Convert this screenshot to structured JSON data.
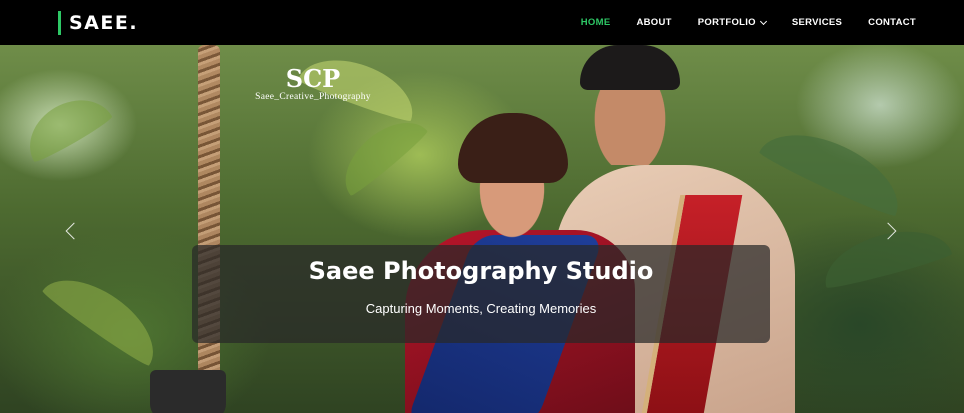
{
  "brand": {
    "name": "SAEE.",
    "accent": "#2ec866"
  },
  "nav": {
    "items": [
      {
        "label": "HOME",
        "active": true
      },
      {
        "label": "ABOUT",
        "active": false
      },
      {
        "label": "PORTFOLIO",
        "active": false,
        "has_dropdown": true
      },
      {
        "label": "SERVICES",
        "active": false
      },
      {
        "label": "CONTACT",
        "active": false
      }
    ]
  },
  "hero": {
    "watermark": {
      "letters": "SCP",
      "subtitle": "Saee_Creative_Photography"
    },
    "title": "Saee Photography Studio",
    "subtitle": "Capturing Moments, Creating Memories",
    "prev_icon": "chevron-left-icon",
    "next_icon": "chevron-right-icon"
  }
}
